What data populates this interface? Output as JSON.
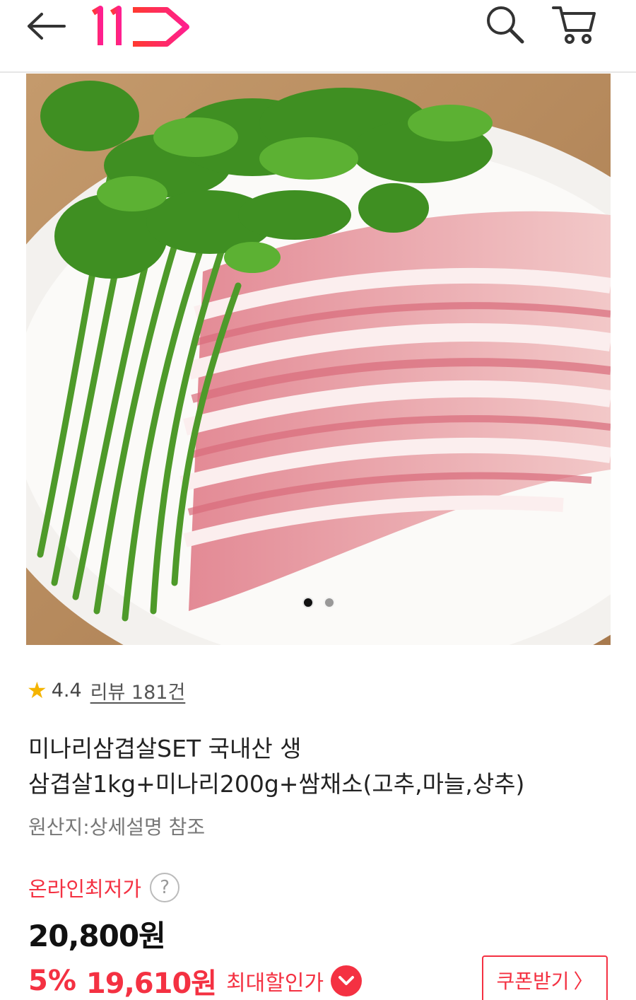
{
  "header": {
    "logo_text": "11",
    "icons": {
      "back": "arrow-left-icon",
      "search": "search-icon",
      "cart": "cart-icon"
    }
  },
  "gallery": {
    "image_count": 2,
    "active_index": 0
  },
  "rating": {
    "score": "4.4",
    "review_link": "리뷰 181건"
  },
  "product": {
    "title_line1": "미나리삼겹살SET 국내산 생",
    "title_line2": "삼겹살1kg+미나리200g+쌈채소(고추,마늘,상추)",
    "origin": "원산지:상세설명 참조"
  },
  "price": {
    "label": "온라인최저가",
    "help": "?",
    "original": "20,800원",
    "discount": "5%",
    "sale": "19,610원",
    "max_label": "최대할인가"
  },
  "coupon": {
    "label": "쿠폰받기",
    "chevron": "〉"
  },
  "colors": {
    "accent": "#f43142",
    "star": "#f4b400"
  }
}
